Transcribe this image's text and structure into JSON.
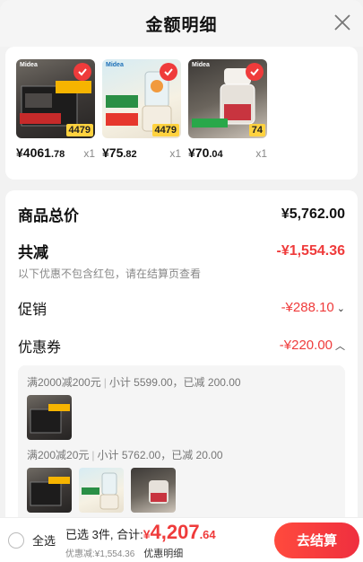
{
  "header": {
    "title": "金额明细"
  },
  "products": [
    {
      "price_int": "¥4061",
      "price_dec": ".78",
      "qty": "x1",
      "brand": "Midea",
      "tag": "4479",
      "tag_color": "#ffd23f"
    },
    {
      "price_int": "¥75",
      "price_dec": ".82",
      "qty": "x1",
      "brand": "Midea",
      "tag": "4479",
      "tag_color": "#ffd23f"
    },
    {
      "price_int": "¥70",
      "price_dec": ".04",
      "qty": "x1",
      "brand": "Midea",
      "tag": "74",
      "tag_color": "#ffd23f"
    }
  ],
  "summary": {
    "total_label": "商品总价",
    "total_value": "¥5,762.00",
    "reduce_label": "共减",
    "reduce_value": "-¥1,554.36",
    "reduce_note": "以下优惠不包含红包，请在结算页查看",
    "promo_label": "促销",
    "promo_value": "-¥288.10",
    "coupon_label": "优惠券",
    "coupon_value": "-¥220.00"
  },
  "coupons": [
    {
      "rule": "满2000减200元",
      "detail": "小计 5599.00，已减 200.00"
    },
    {
      "rule": "满200减20元",
      "detail": "小计 5762.00，已减 20.00"
    }
  ],
  "footer": {
    "select_all": "全选",
    "selected_text": "已选 3件, 合计:",
    "total_cur": "¥",
    "total_int": "4,207",
    "total_dec": ".64",
    "discount_text": "优惠减:¥1,554.36",
    "detail_link": "优惠明细",
    "checkout": "去结算"
  },
  "colors": {
    "accent": "#ef3b3b",
    "checkout": "#ef2f3f"
  }
}
